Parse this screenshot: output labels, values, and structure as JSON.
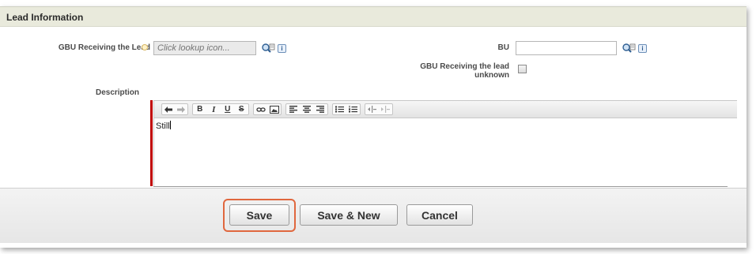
{
  "section": {
    "title": "Lead Information"
  },
  "fields": {
    "gbu_receiving_lead": {
      "label": "GBU Receiving the Lead",
      "placeholder": "Click lookup icon...",
      "lookup_icon": "lookup-magnifier-icon",
      "info_icon_glyph": "i"
    },
    "bu": {
      "label": "BU",
      "value": "",
      "lookup_icon": "lookup-magnifier-icon",
      "info_icon_glyph": "i"
    },
    "gbu_lead_unknown": {
      "label_line1": "GBU Receiving the lead",
      "label_line2": "unknown",
      "checked": false
    },
    "description": {
      "label": "Description",
      "text": "Still"
    }
  },
  "toolbar": {
    "bold": "B",
    "italic": "I",
    "underline": "U",
    "strike": "S"
  },
  "buttons": {
    "save": "Save",
    "save_new": "Save & New",
    "cancel": "Cancel"
  },
  "colors": {
    "section_header_bg": "#e9eadc",
    "required_bar": "#c00000",
    "highlight": "#e0673e"
  }
}
